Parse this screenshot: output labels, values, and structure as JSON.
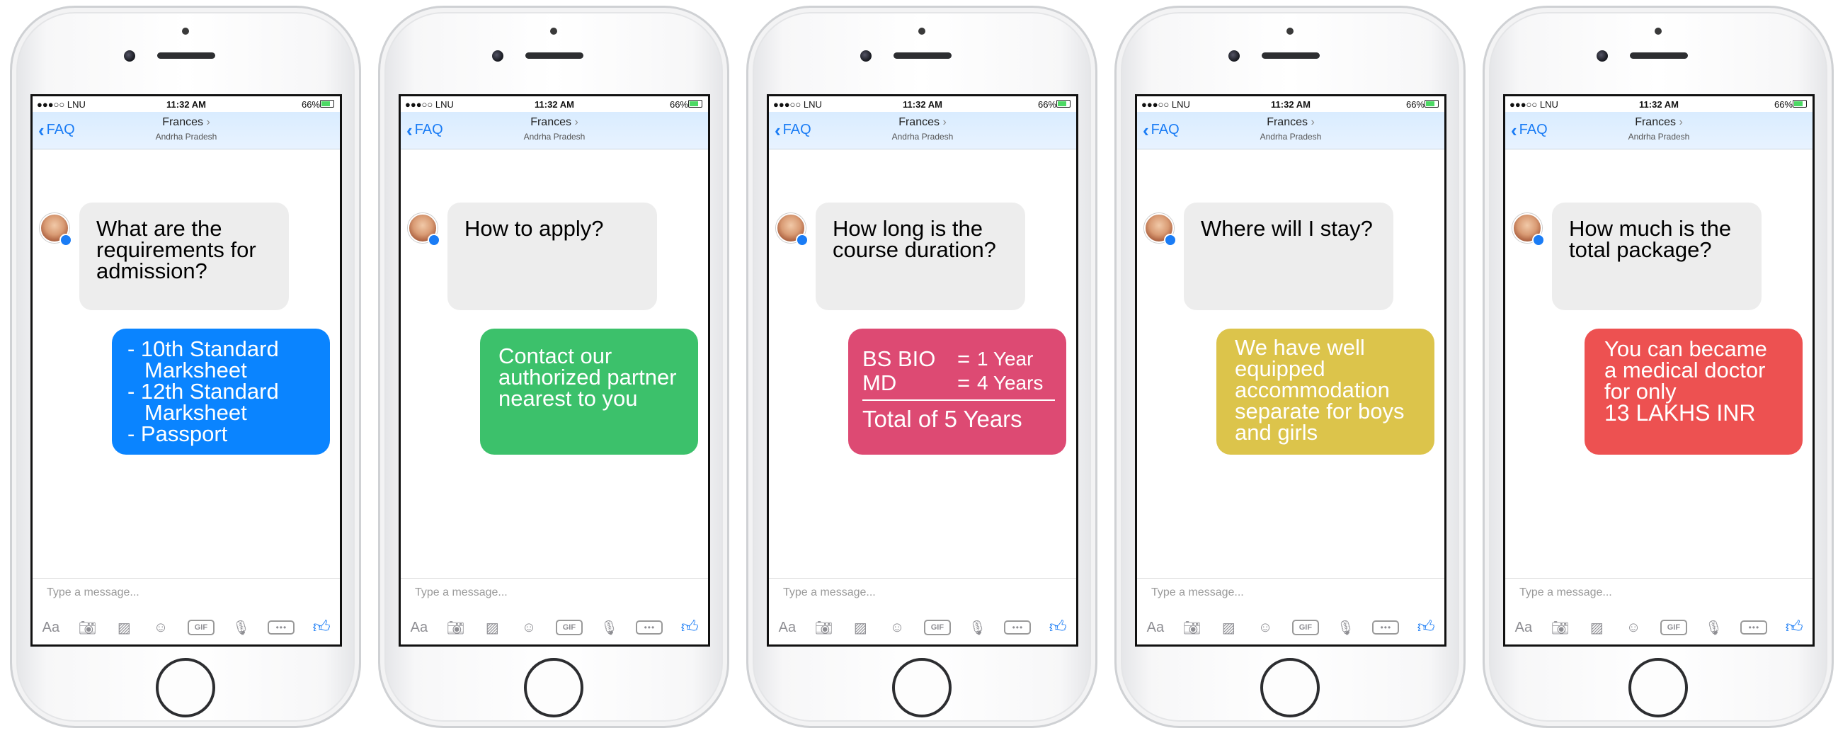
{
  "status_bar": {
    "carrier": "●●●○○ LNU",
    "time": "11:32 AM",
    "battery": "66%"
  },
  "navbar": {
    "back_label": "FAQ",
    "contact_name": "Frances",
    "contact_subtitle": "Andrha Pradesh"
  },
  "composer": {
    "placeholder": "Type a message..."
  },
  "toolbar_icons": [
    "text-format-icon",
    "camera-icon",
    "gallery-icon",
    "emoji-icon",
    "gif-icon",
    "microphone-icon",
    "more-icon",
    "like-icon"
  ],
  "toolbar_labels": {
    "aa": "Aa",
    "gif": "GIF"
  },
  "colors": {
    "blue": "#0a84ff",
    "green": "#3cc16b",
    "pink": "#dd4a73",
    "yellow": "#dcc44b",
    "red": "#ed5151",
    "accent": "#1a7cf5"
  },
  "phones": [
    {
      "question": "What are the requirements for admission?",
      "answer_lines": [
        "- 10th Standard",
        "Marksheet",
        "- 12th Standard",
        "Marksheet",
        "- Passport"
      ]
    },
    {
      "question": "How to apply?",
      "answer": "Contact our authorized partner nearest to you"
    },
    {
      "question": "How long is the course duration?",
      "answer_table": {
        "rows": [
          {
            "key": "BS BIO",
            "value": "1 Year"
          },
          {
            "key": "MD",
            "value": "4 Years"
          }
        ],
        "total": "Total of 5 Years"
      }
    },
    {
      "question": "Where will I stay?",
      "answer": "We have well equipped accommodation separate for boys and girls"
    },
    {
      "question": "How much is the total package?",
      "answer_lines": [
        "You can became",
        "a medical doctor",
        "for only",
        "13 LAKHS INR"
      ]
    }
  ]
}
